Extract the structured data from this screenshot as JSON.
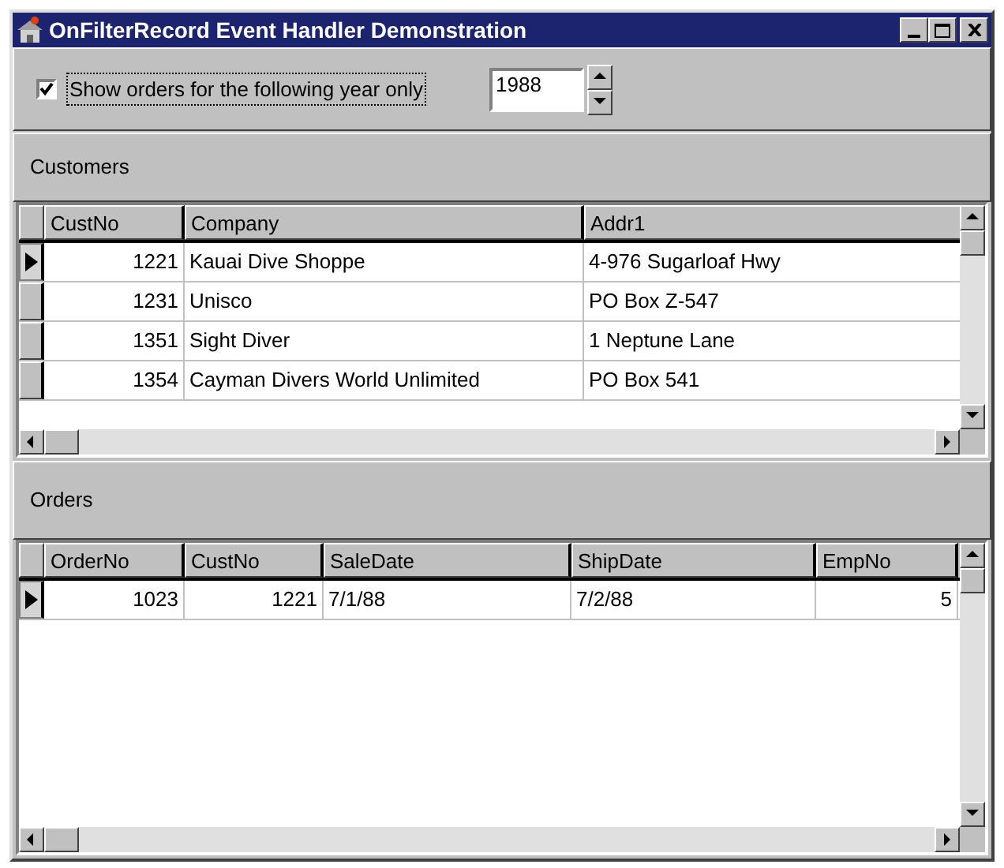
{
  "window": {
    "title": "OnFilterRecord Event Handler Demonstration"
  },
  "filter": {
    "label": "Show orders for the following year only",
    "checked": true,
    "year": "1988"
  },
  "customers": {
    "title": "Customers",
    "columns": [
      {
        "label": "CustNo",
        "kind": "number"
      },
      {
        "label": "Company",
        "kind": "text"
      },
      {
        "label": "Addr1",
        "kind": "text"
      }
    ],
    "rows": [
      {
        "selected": true,
        "cells": [
          "1221",
          "Kauai Dive Shoppe",
          "4-976 Sugarloaf Hwy"
        ]
      },
      {
        "selected": false,
        "cells": [
          "1231",
          "Unisco",
          "PO Box Z-547"
        ]
      },
      {
        "selected": false,
        "cells": [
          "1351",
          "Sight Diver",
          "1 Neptune Lane"
        ]
      },
      {
        "selected": false,
        "cells": [
          "1354",
          "Cayman Divers World Unlimited",
          "PO Box 541"
        ]
      }
    ]
  },
  "orders": {
    "title": "Orders",
    "columns": [
      {
        "label": "OrderNo",
        "kind": "number"
      },
      {
        "label": "CustNo",
        "kind": "number"
      },
      {
        "label": "SaleDate",
        "kind": "text"
      },
      {
        "label": "ShipDate",
        "kind": "text"
      },
      {
        "label": "EmpNo",
        "kind": "number"
      }
    ],
    "rows": [
      {
        "selected": true,
        "cells": [
          "1023",
          "1221",
          "7/1/88",
          "7/2/88",
          "5"
        ]
      }
    ]
  }
}
